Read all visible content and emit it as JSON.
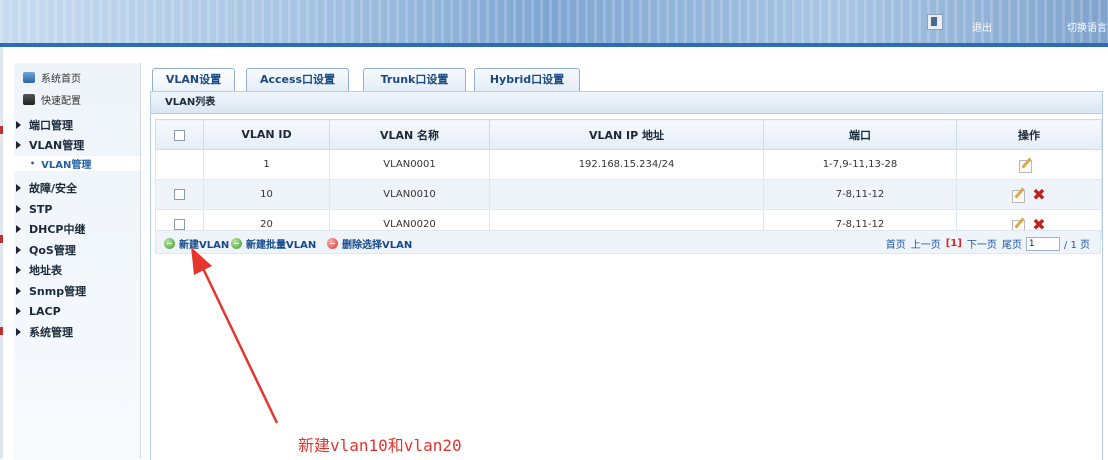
{
  "header": {
    "logout_label": "退出",
    "language_label": "切换语言"
  },
  "sidebar": {
    "top_links": [
      {
        "label": "系统首页",
        "icon": "home-icon"
      },
      {
        "label": "快速配置",
        "icon": "quick-config-icon"
      }
    ],
    "menu": [
      "端口管理",
      "VLAN管理",
      "故障/安全",
      "STP",
      "DHCP中继",
      "QoS管理",
      "地址表",
      "Snmp管理",
      "LACP",
      "系统管理"
    ],
    "active_sub": "VLAN管理"
  },
  "tabs": [
    "VLAN设置",
    "Access口设置",
    "Trunk口设置",
    "Hybrid口设置"
  ],
  "panel": {
    "title": "VLAN列表",
    "columns": [
      "VLAN ID",
      "VLAN 名称",
      "VLAN IP 地址",
      "端口",
      "操作"
    ],
    "rows": [
      {
        "id": "1",
        "name": "VLAN0001",
        "ip": "192.168.15.234/24",
        "ports": "1-7,9-11,13-28"
      },
      {
        "id": "10",
        "name": "VLAN0010",
        "ip": "",
        "ports": "7-8,11-12"
      },
      {
        "id": "20",
        "name": "VLAN0020",
        "ip": "",
        "ports": "7-8,11-12"
      }
    ],
    "actions": {
      "new_vlan": "新建VLAN",
      "new_batch_vlan": "新建批量VLAN",
      "delete_selected": "删除选择VLAN"
    },
    "pager": {
      "first": "首页",
      "prev": "上一页",
      "current": "[1]",
      "next": "下一页",
      "last": "尾页",
      "page_input": "1",
      "total": "/ 1 页"
    }
  },
  "annotation": "新建vlan10和vlan20",
  "colors": {
    "header_blue": "#2e6db3",
    "tab_text": "#1a4a83",
    "annotation_red": "#e5352d",
    "delete_red": "#c2221b"
  }
}
